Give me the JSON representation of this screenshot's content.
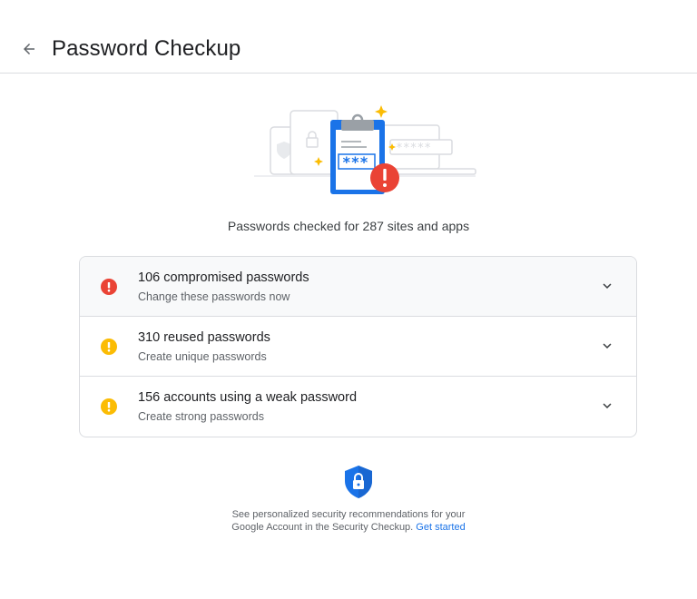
{
  "header": {
    "title": "Password Checkup"
  },
  "summary": {
    "checked_text": "Passwords checked for 287 sites and apps"
  },
  "issues": [
    {
      "title": "106 compromised passwords",
      "subtitle": "Change these passwords now",
      "severity": "error",
      "icon": "error-icon",
      "color": "#ea4335"
    },
    {
      "title": "310 reused passwords",
      "subtitle": "Create unique passwords",
      "severity": "warning",
      "icon": "warning-icon",
      "color": "#fbbc04"
    },
    {
      "title": "156 accounts using a weak password",
      "subtitle": "Create strong passwords",
      "severity": "warning",
      "icon": "warning-icon",
      "color": "#fbbc04"
    }
  ],
  "illustration": {
    "masked_password": "***",
    "masked_field": "*****"
  },
  "footer": {
    "line1": "See personalized security recommendations for your",
    "line2": "Google Account in the Security Checkup.",
    "link": "Get started"
  },
  "colors": {
    "accent_blue": "#1a73e8",
    "error_red": "#ea4335",
    "warning_yellow": "#fbbc04",
    "divider": "#dadce0"
  }
}
